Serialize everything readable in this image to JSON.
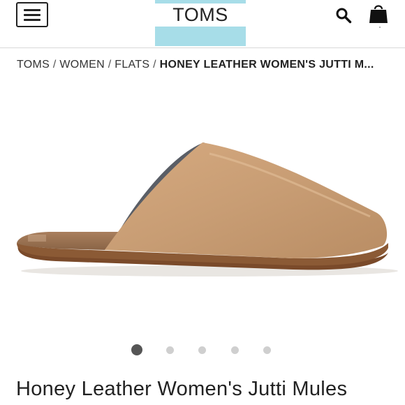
{
  "header": {
    "logo": "TOMS",
    "brand_color": "#a7dde8",
    "menu_icon": "hamburger-menu-icon",
    "search_icon": "search-icon",
    "cart_icon": "shopping-bag-icon"
  },
  "breadcrumb": {
    "items": [
      "TOMS",
      "WOMEN",
      "FLATS"
    ],
    "separator": "/",
    "current": "HONEY LEATHER WOMEN'S JUTTI M..."
  },
  "gallery": {
    "image_subject": "Honey leather mule shoe",
    "dot_count": 5,
    "active_index": 0
  },
  "product": {
    "title": "Honey Leather Women's Jutti Mules"
  }
}
